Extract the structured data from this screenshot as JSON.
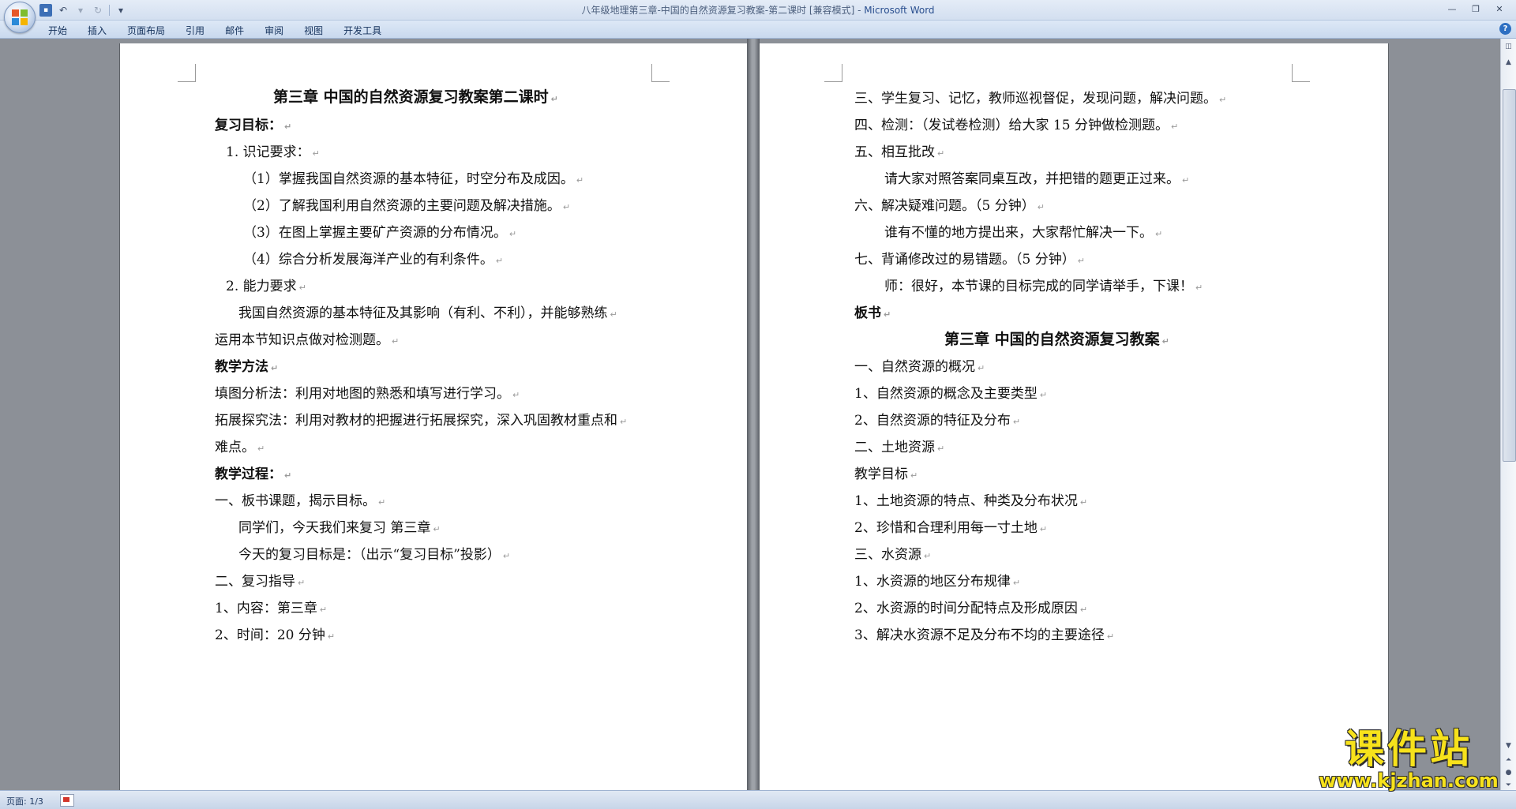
{
  "window": {
    "title": "八年级地理第三章-中国的自然资源复习教案-第二课时 [兼容模式]",
    "app": "Microsoft Word"
  },
  "quick_access": {
    "save_icon": "save-icon",
    "undo_icon": "undo-icon",
    "redo_icon": "redo-icon",
    "customize_icon": "dropdown-icon"
  },
  "ribbon": {
    "tabs": [
      "开始",
      "插入",
      "页面布局",
      "引用",
      "邮件",
      "审阅",
      "视图",
      "开发工具"
    ]
  },
  "document": {
    "left_page": [
      {
        "text": "第三章  中国的自然资源复习教案第二课时",
        "style": "title"
      },
      {
        "text": "复习目标：",
        "style": "bold"
      },
      {
        "text": "1.  识记要求：",
        "style": "normal"
      },
      {
        "text": "（1）掌握我国自然资源的基本特征，时空分布及成因。",
        "style": "normal"
      },
      {
        "text": "（2）了解我国利用自然资源的主要问题及解决措施。",
        "style": "normal"
      },
      {
        "text": "（3）在图上掌握主要矿产资源的分布情况。",
        "style": "normal"
      },
      {
        "text": "（4）综合分析发展海洋产业的有利条件。",
        "style": "normal"
      },
      {
        "text": "2.  能力要求",
        "style": "normal"
      },
      {
        "text": "我国自然资源的基本特征及其影响（有利、不利），并能够熟练",
        "style": "normal"
      },
      {
        "text": "运用本节知识点做对检测题。",
        "style": "normal"
      },
      {
        "text": "教学方法",
        "style": "bold"
      },
      {
        "text": "填图分析法：利用对地图的熟悉和填写进行学习。",
        "style": "normal"
      },
      {
        "text": "拓展探究法：利用对教材的把握进行拓展探究，深入巩固教材重点和",
        "style": "normal"
      },
      {
        "text": "难点。",
        "style": "normal"
      },
      {
        "text": "教学过程：",
        "style": "bold"
      },
      {
        "text": "一、板书课题，揭示目标。",
        "style": "normal"
      },
      {
        "text": "同学们，今天我们来复习      第三章",
        "style": "normal"
      },
      {
        "text": "今天的复习目标是：（出示“复习目标”投影）",
        "style": "normal"
      },
      {
        "text": "二、复习指导",
        "style": "normal"
      },
      {
        "text": "1、内容：第三章",
        "style": "normal"
      },
      {
        "text": "2、时间：20 分钟",
        "style": "normal"
      }
    ],
    "right_page": [
      {
        "text": "三、学生复习、记忆，教师巡视督促，发现问题，解决问题。",
        "style": "normal"
      },
      {
        "text": "四、检测：（发试卷检测）给大家 15 分钟做检测题。",
        "style": "normal"
      },
      {
        "text": "五、相互批改",
        "style": "normal"
      },
      {
        "text": "请大家对照答案同桌互改，并把错的题更正过来。",
        "style": "normal"
      },
      {
        "text": "六、解决疑难问题。（5 分钟）",
        "style": "normal"
      },
      {
        "text": "谁有不懂的地方提出来，大家帮忙解决一下。",
        "style": "normal"
      },
      {
        "text": "七、背诵修改过的易错题。（5 分钟）",
        "style": "normal"
      },
      {
        "text": "师：很好，本节课的目标完成的同学请举手，下课！",
        "style": "normal"
      },
      {
        "text": "板书",
        "style": "bold"
      },
      {
        "text": "第三章  中国的自然资源复习教案",
        "style": "title"
      },
      {
        "text": "一、自然资源的概况",
        "style": "normal"
      },
      {
        "text": "1、自然资源的概念及主要类型",
        "style": "normal"
      },
      {
        "text": "2、自然资源的特征及分布",
        "style": "normal"
      },
      {
        "text": "二、土地资源",
        "style": "normal"
      },
      {
        "text": "教学目标",
        "style": "normal"
      },
      {
        "text": "1、土地资源的特点、种类及分布状况",
        "style": "normal"
      },
      {
        "text": "2、珍惜和合理利用每一寸土地",
        "style": "normal"
      },
      {
        "text": "三、水资源",
        "style": "normal"
      },
      {
        "text": "1、水资源的地区分布规律",
        "style": "normal"
      },
      {
        "text": "2、水资源的时间分配特点及形成原因",
        "style": "normal"
      },
      {
        "text": "3、解决水资源不足及分布不均的主要途径",
        "style": "normal"
      }
    ]
  },
  "statusbar": {
    "page_info": "页面: 1/3"
  },
  "watermark": {
    "main": "课件站",
    "url": "www.kjzhan.com"
  }
}
